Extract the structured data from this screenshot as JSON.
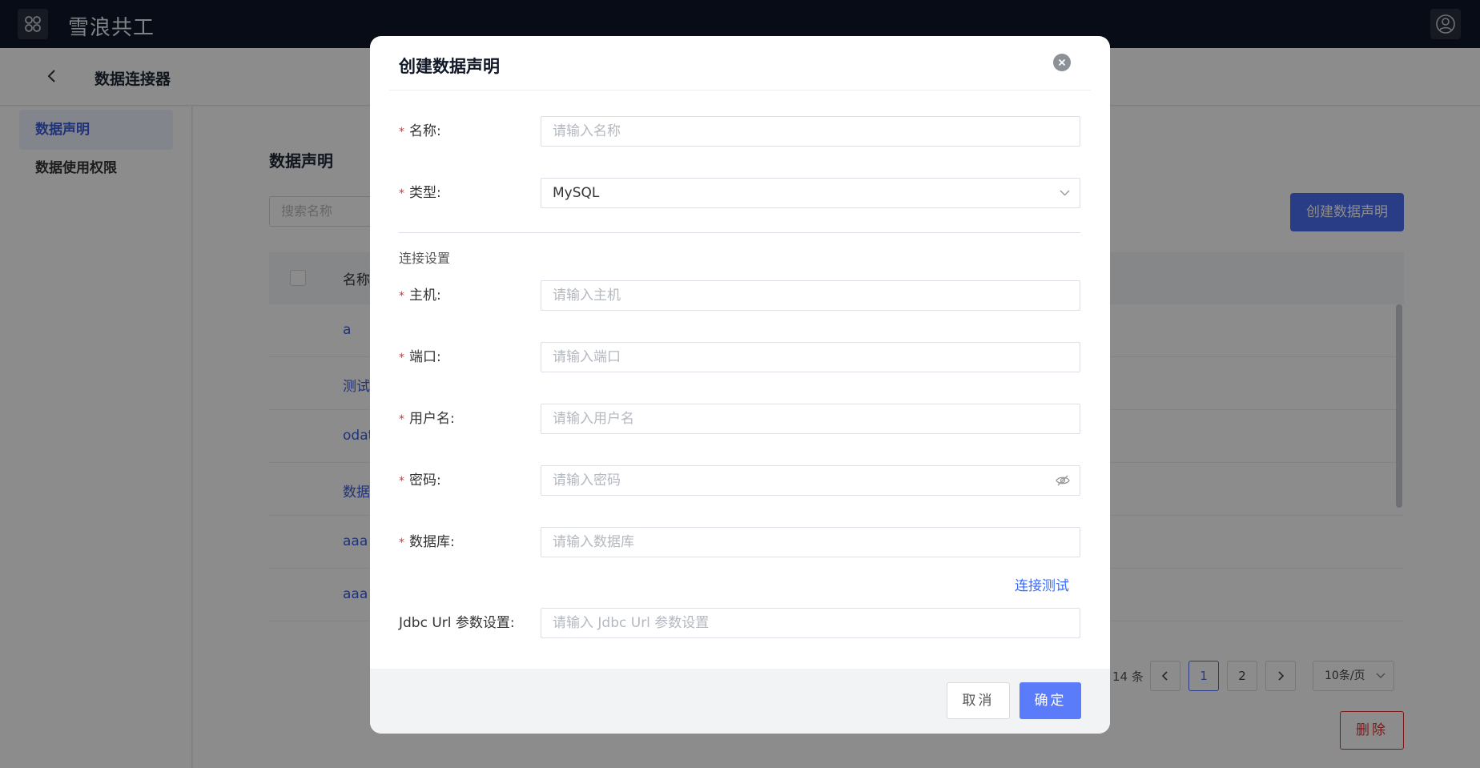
{
  "app": {
    "title": "雪浪共工"
  },
  "subheader": {
    "title": "数据连接器"
  },
  "sidebar": {
    "items": [
      {
        "label": "数据声明",
        "active": true
      },
      {
        "label": "数据使用权限",
        "active": false
      }
    ]
  },
  "main": {
    "title": "数据声明",
    "search_placeholder": "搜索名称",
    "create_button": "创建数据声明",
    "table": {
      "header": "名称",
      "rows": [
        "a",
        "测试",
        "odat",
        "数据",
        "aaa",
        "aaa"
      ]
    },
    "pagination": {
      "total": "14 条",
      "pages": [
        "1",
        "2"
      ],
      "current": "1",
      "page_size": "10条/页"
    },
    "delete_button": "删除"
  },
  "modal": {
    "title": "创建数据声明",
    "fields": {
      "name": {
        "label": "名称:",
        "placeholder": "请输入名称"
      },
      "type": {
        "label": "类型:",
        "value": "MySQL"
      },
      "host": {
        "label": "主机:",
        "placeholder": "请输入主机"
      },
      "port": {
        "label": "端口:",
        "placeholder": "请输入端口"
      },
      "username": {
        "label": "用户名:",
        "placeholder": "请输入用户名"
      },
      "password": {
        "label": "密码:",
        "placeholder": "请输入密码"
      },
      "database": {
        "label": "数据库:",
        "placeholder": "请输入数据库"
      },
      "jdbc": {
        "label": "Jdbc Url 参数设置:",
        "placeholder": "请输入 Jdbc Url 参数设置"
      }
    },
    "section_label": "连接设置",
    "test_link": "连接测试",
    "cancel_button": "取消",
    "ok_button": "确定"
  },
  "colors": {
    "accent": "#4c6ef5",
    "topbar": "#0f172a",
    "danger": "#e03131"
  },
  "icons": [
    "apps-grid-icon",
    "user-circle-icon",
    "chevron-left-icon",
    "close-icon",
    "chevron-down-icon",
    "eye-off-icon",
    "chevron-right-icon"
  ]
}
